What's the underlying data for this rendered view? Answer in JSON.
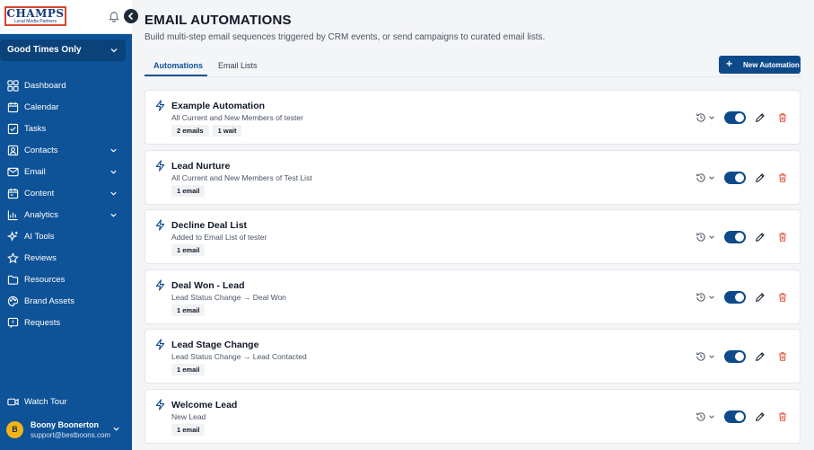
{
  "brand": {
    "logo_main": "CHAMPS",
    "logo_sub": "Local Media Partners",
    "bell_icon": "bell-icon",
    "collapse_icon": "chevron-left-icon"
  },
  "workspace": {
    "label": "Good Times Only"
  },
  "nav": [
    {
      "label": "Dashboard",
      "icon": "dashboard-icon",
      "expandable": false
    },
    {
      "label": "Calendar",
      "icon": "calendar-icon",
      "expandable": false
    },
    {
      "label": "Tasks",
      "icon": "tasks-icon",
      "expandable": false
    },
    {
      "label": "Contacts",
      "icon": "contacts-icon",
      "expandable": true
    },
    {
      "label": "Email",
      "icon": "email-icon",
      "expandable": true
    },
    {
      "label": "Content",
      "icon": "content-icon",
      "expandable": true
    },
    {
      "label": "Analytics",
      "icon": "analytics-icon",
      "expandable": true
    },
    {
      "label": "AI Tools",
      "icon": "sparkle-icon",
      "expandable": false
    },
    {
      "label": "Reviews",
      "icon": "star-icon",
      "expandable": false
    },
    {
      "label": "Resources",
      "icon": "folder-icon",
      "expandable": false
    },
    {
      "label": "Brand Assets",
      "icon": "palette-icon",
      "expandable": false
    },
    {
      "label": "Requests",
      "icon": "request-icon",
      "expandable": false
    }
  ],
  "watch_tour": {
    "label": "Watch Tour"
  },
  "user": {
    "initial": "B",
    "name": "Boony Boonerton",
    "email": "support@bestboons.com"
  },
  "header": {
    "title": "EMAIL AUTOMATIONS",
    "subtitle": "Build multi-step email sequences triggered by CRM events, or send campaigns to curated email lists."
  },
  "tabs": [
    {
      "label": "Automations",
      "active": true
    },
    {
      "label": "Email Lists",
      "active": false
    }
  ],
  "new_button": {
    "label": "New Automation"
  },
  "automations": [
    {
      "name": "Example Automation",
      "desc": "All Current and New Members of tester",
      "chips": [
        "2 emails",
        "1 wait"
      ],
      "enabled": true
    },
    {
      "name": "Lead Nurture",
      "desc": "All Current and New Members of Test List",
      "chips": [
        "1 email"
      ],
      "enabled": true
    },
    {
      "name": "Decline Deal List",
      "desc": "Added to Email List of tester",
      "chips": [
        "1 email"
      ],
      "enabled": true
    },
    {
      "name": "Deal Won - Lead",
      "desc": "Lead Status Change → Deal Won",
      "chips": [
        "1 email"
      ],
      "enabled": true
    },
    {
      "name": "Lead Stage Change",
      "desc": "Lead Status Change → Lead Contacted",
      "chips": [
        "1 email"
      ],
      "enabled": true
    },
    {
      "name": "Welcome Lead",
      "desc": "New Lead",
      "chips": [
        "1 email"
      ],
      "enabled": true
    }
  ],
  "colors": {
    "sidebar": "#0e5297",
    "accent": "#0e4a8a",
    "danger": "#e0553d"
  }
}
